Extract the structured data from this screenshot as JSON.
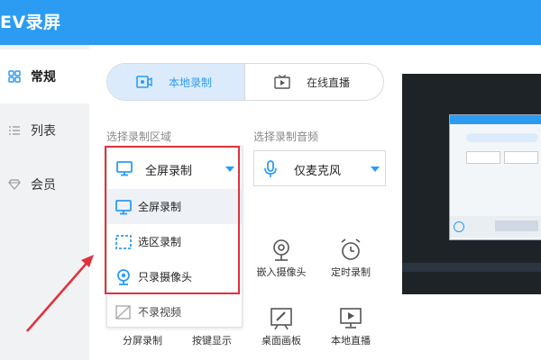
{
  "app": {
    "title": "EV录屏"
  },
  "sidebar": {
    "items": [
      {
        "label": "常规",
        "icon": "grid-icon",
        "active": true
      },
      {
        "label": "列表",
        "icon": "list-icon",
        "active": false
      },
      {
        "label": "会员",
        "icon": "diamond-icon",
        "active": false
      }
    ]
  },
  "mode_tabs": [
    {
      "label": "本地录制",
      "icon": "video-record-icon",
      "active": true
    },
    {
      "label": "在线直播",
      "icon": "tv-icon",
      "active": false
    }
  ],
  "record_area": {
    "label": "选择录制区域",
    "selected": "全屏录制",
    "options": [
      {
        "label": "全屏录制",
        "icon": "monitor-icon"
      },
      {
        "label": "选区录制",
        "icon": "dashed-selection-icon"
      },
      {
        "label": "只录摄像头",
        "icon": "webcam-icon"
      },
      {
        "label": "不录视频",
        "icon": "no-video-icon"
      }
    ]
  },
  "audio": {
    "label": "选择录制音频",
    "selected": "仅麦克风",
    "icon": "microphone-icon"
  },
  "tools": [
    {
      "label": "嵌入摄像头",
      "icon": "webcam-icon"
    },
    {
      "label": "定时录制",
      "icon": "alarm-clock-icon"
    },
    {
      "label": "分屏录制",
      "icon": "split-screen-icon"
    },
    {
      "label": "按键显示",
      "icon": "keyboard-icon"
    },
    {
      "label": "桌面画板",
      "icon": "drawing-board-icon"
    },
    {
      "label": "本地直播",
      "icon": "live-screen-icon"
    }
  ],
  "colors": {
    "header": "#2b9cf2",
    "accent": "#2b9cf2",
    "highlight_box": "#e0313d",
    "sidebar_bg": "#f1f2f4"
  }
}
